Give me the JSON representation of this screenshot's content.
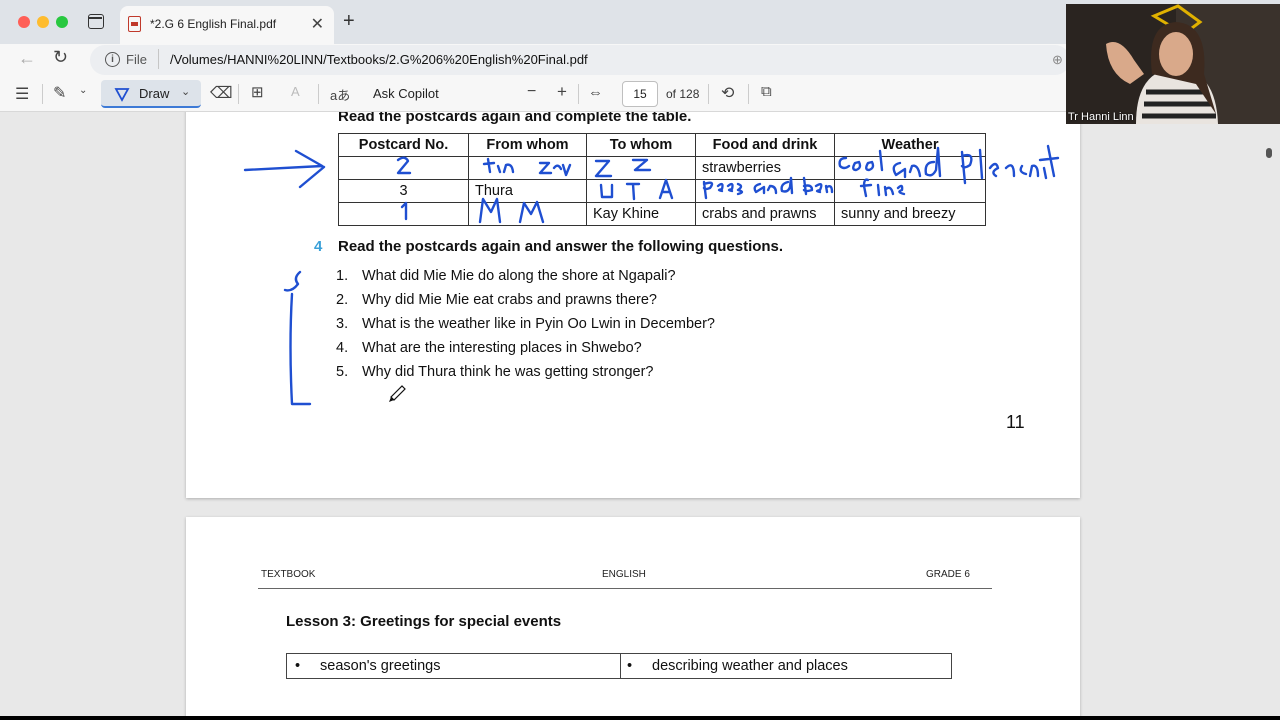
{
  "browser": {
    "tab": {
      "title": "*2.G 6 English Final.pdf",
      "close_glyph": "✕"
    },
    "new_tab_glyph": "+",
    "address": {
      "scheme_label": "File",
      "url": "/Volumes/HANNI%20LINN/Textbooks/2.G%206%20English%20Final.pdf"
    }
  },
  "pdf_toolbar": {
    "draw_label": "Draw",
    "ask_copilot_label": "Ask Copilot",
    "read_aloud_glyph": "aあ",
    "zoom_out_glyph": "−",
    "zoom_in_glyph": "+",
    "page_current": "15",
    "page_total_label": "of 128"
  },
  "page11": {
    "heading": "Read the postcards again and complete the table.",
    "table": {
      "headers": [
        "Postcard No.",
        "From whom",
        "To whom",
        "Food and drink",
        "Weather"
      ],
      "rows": [
        [
          "",
          "",
          "",
          "strawberries",
          ""
        ],
        [
          "3",
          "Thura",
          "",
          "",
          ""
        ],
        [
          "",
          "",
          "Kay Khine",
          "crabs and prawns",
          "sunny and breezy"
        ]
      ]
    },
    "question_number": "4",
    "question_heading": "Read the postcards again and answer the following questions.",
    "questions": [
      {
        "n": "1.",
        "text": "What did Mie Mie do along the shore at Ngapali?"
      },
      {
        "n": "2.",
        "text": "Why did Mie Mie eat crabs and prawns there?"
      },
      {
        "n": "3.",
        "text": "What is the weather like in Pyin Oo Lwin in December?"
      },
      {
        "n": "4.",
        "text": "What are the interesting places in Shwebo?"
      },
      {
        "n": "5.",
        "text": "Why did Thura think he was getting stronger?"
      }
    ],
    "page_number": "11"
  },
  "page12": {
    "header_left": "TEXTBOOK",
    "header_center": "ENGLISH",
    "header_right": "GRADE 6",
    "lesson_title": "Lesson 3: Greetings for special events",
    "topics": [
      "season's greetings",
      "describing weather and places"
    ]
  },
  "annotations": {
    "ink_color": "#1f4fd1",
    "handwriting": [
      "2",
      "tin zay",
      "z z",
      "cool and pleasant",
      "pees and ben",
      "fine",
      "1",
      "M M"
    ]
  },
  "webcam": {
    "label": "Tr Hanni Linn"
  },
  "colors": {
    "accent_blue": "#3aa0d8",
    "close_red": "#ff5f57",
    "minimize_yellow": "#febc2e",
    "zoom_green": "#28c840"
  }
}
